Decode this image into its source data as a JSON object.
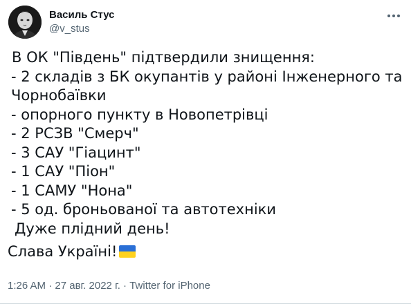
{
  "author": {
    "display_name": "Василь Стус",
    "handle": "@v_stus"
  },
  "tweet": {
    "lines": [
      "В ОК \"Південь\" підтвердили знищення:",
      "- 2 складів з БК окупантів у районі Інженерного та",
      "Чорнобаївки",
      "- опорного пункту в Новопетрівці",
      "- 2 РСЗВ \"Смерч\"",
      "- 3 САУ \"Гіацинт\"",
      "- 1 САУ \"Піон\"",
      "- 1 САМУ \"Нона\"",
      "- 5 од. броньованої та автотехніки"
    ],
    "closing": "Дуже плідний день!",
    "slava": "Слава Україні!"
  },
  "meta": {
    "time": "1:26 AM",
    "separator": "·",
    "date": "27 авг. 2022 г.",
    "source": "Twitter for iPhone"
  },
  "icons": {
    "more": "more-horizontal-icon",
    "flag": "ukraine-flag-emoji"
  },
  "colors": {
    "text_primary": "#0f1419",
    "text_secondary": "#536471",
    "flag_blue": "#2a6fd6",
    "flag_yellow": "#ffd21f"
  }
}
